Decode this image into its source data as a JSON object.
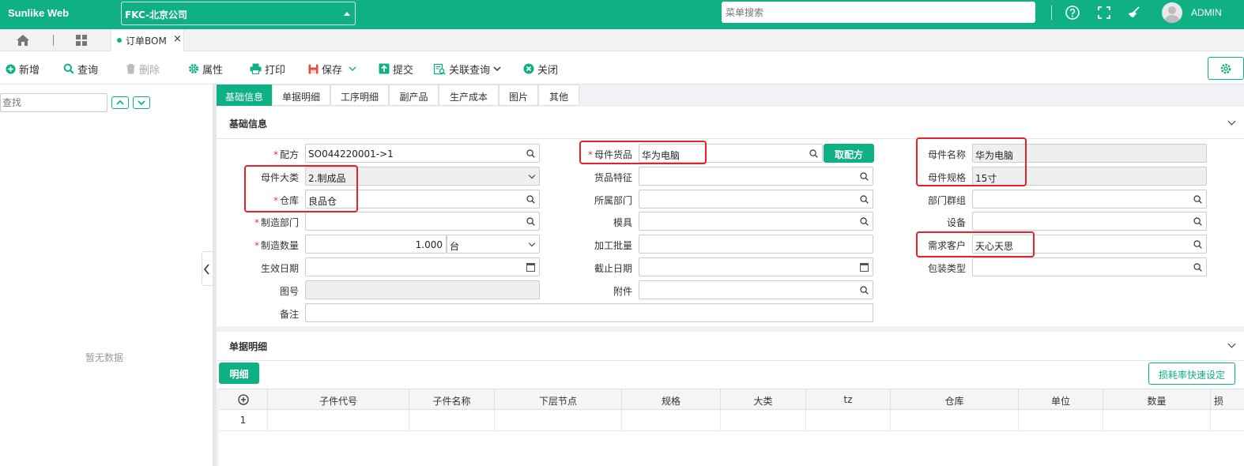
{
  "app": {
    "brand": "Sunlike Web",
    "company": "FKC-北京公司",
    "menu_search_placeholder": "菜单搜索",
    "user": "ADMIN"
  },
  "tabs": {
    "document_tab": "订单BOM"
  },
  "toolbar": {
    "new": "新增",
    "query": "查询",
    "delete": "删除",
    "properties": "属性",
    "print": "打印",
    "save": "保存",
    "submit": "提交",
    "related_query": "关联查询",
    "close": "关闭"
  },
  "left": {
    "find_placeholder": "查找",
    "empty": "暂无数据"
  },
  "form_tabs": [
    "基础信息",
    "单据明细",
    "工序明细",
    "副产品",
    "生产成本",
    "图片",
    "其他"
  ],
  "basic": {
    "title": "基础信息",
    "formula_label": "配方",
    "formula_value": "SO044220001->1",
    "parent_category_label": "母件大类",
    "parent_category_value": "2.制成品",
    "warehouse_label": "仓库",
    "warehouse_value": "良品仓",
    "mfg_dept_label": "制造部门",
    "mfg_qty_label": "制造数量",
    "mfg_qty_value": "1.000",
    "unit_value": "台",
    "effective_date_label": "生效日期",
    "drawing_no_label": "图号",
    "remark_label": "备注",
    "parent_item_label": "母件货品",
    "parent_item_value": "华为电脑",
    "get_formula_button": "取配方",
    "item_feature_label": "货品特征",
    "dept_label": "所属部门",
    "mold_label": "模具",
    "batch_label": "加工批量",
    "end_date_label": "截止日期",
    "attachment_label": "附件",
    "parent_name_label": "母件名称",
    "parent_name_value": "华为电脑",
    "parent_spec_label": "母件规格",
    "parent_spec_value": "15寸",
    "dept_group_label": "部门群组",
    "equipment_label": "设备",
    "customer_label": "需求客户",
    "customer_value": "天心天思",
    "package_label": "包装类型"
  },
  "detail": {
    "title": "单据明细",
    "detail_button": "明细",
    "loss_rate_button": "损耗率快速设定",
    "columns": [
      "子件代号",
      "子件名称",
      "下层节点",
      "规格",
      "大类",
      "tz",
      "仓库",
      "单位",
      "数量",
      "损"
    ],
    "rows": [
      {
        "index": "1"
      }
    ]
  },
  "colors": {
    "accent": "#10b085",
    "highlight": "#e8202a"
  }
}
